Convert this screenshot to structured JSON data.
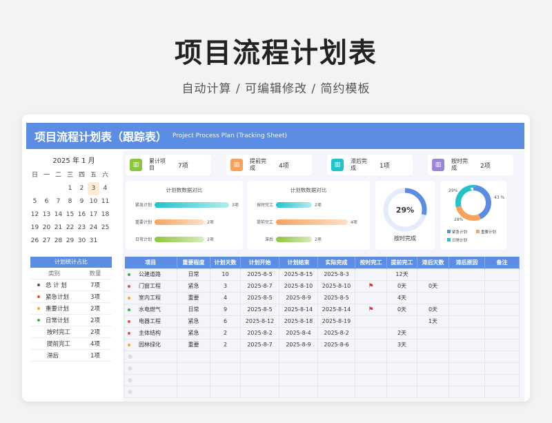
{
  "hero": {
    "title": "项目流程计划表",
    "subtitle": "自动计算 /  可编辑修改  / 简约模板"
  },
  "banner": {
    "title": "项目流程计划表（跟踪表）",
    "subtitle": "Project Process Plan (Tracking Sheet)"
  },
  "calendar": {
    "header": "2025 年  1 月",
    "weekdays": [
      "日",
      "一",
      "二",
      "三",
      "四",
      "五",
      "六"
    ],
    "today": "3",
    "days": [
      "",
      "",
      "",
      "1",
      "2",
      "3",
      "4",
      "5",
      "6",
      "7",
      "8",
      "9",
      "10",
      "11",
      "12",
      "13",
      "14",
      "15",
      "16",
      "17",
      "18",
      "19",
      "20",
      "21",
      "22",
      "23",
      "24",
      "25",
      "26",
      "27",
      "28",
      "29",
      "30",
      "31",
      "",
      ""
    ]
  },
  "stats": {
    "title": "计划统计占比",
    "col_category": "类别",
    "col_count": "数量",
    "rows": [
      {
        "label": "总 计 划",
        "value": "7项",
        "dot": "#555555"
      },
      {
        "label": "紧急计划",
        "value": "3项",
        "dot": "#e84b4b"
      },
      {
        "label": "重要计划",
        "value": "2项",
        "dot": "#f5a623"
      },
      {
        "label": "日常计划",
        "value": "2项",
        "dot": "#34b04a"
      },
      {
        "label": "按时完工",
        "value": "2项",
        "dot": ""
      },
      {
        "label": "提前完工",
        "value": "4项",
        "dot": ""
      },
      {
        "label": "滞后",
        "value": "1项",
        "dot": ""
      }
    ]
  },
  "kpis": [
    {
      "label": "累计项目",
      "value": "7项",
      "color": "#8cc63f",
      "icon": "chart-icon"
    },
    {
      "label": "提前完成",
      "value": "4项",
      "color": "#f7a25c",
      "icon": "chart-icon"
    },
    {
      "label": "滞后完成",
      "value": "1项",
      "color": "#22c3c9",
      "icon": "chart-icon"
    },
    {
      "label": "按时完成",
      "value": "2项",
      "color": "#9b86d9",
      "icon": "chart-icon"
    }
  ],
  "panel1": {
    "title": "计划数数据对比",
    "rows": [
      {
        "label": "紧急计划",
        "value": "3项",
        "num": 3,
        "color": "#22c3c9"
      },
      {
        "label": "重要计划",
        "value": "2项",
        "num": 2,
        "color": "#f7a25c"
      },
      {
        "label": "日常计划",
        "value": "2项",
        "num": 2,
        "color": "#8cc63f"
      }
    ]
  },
  "panel2": {
    "title": "计划数数据对比",
    "rows": [
      {
        "label": "按时完工",
        "value": "2项",
        "num": 2,
        "color": "#22c3c9"
      },
      {
        "label": "提前完工",
        "value": "4项",
        "num": 4,
        "color": "#f7a25c"
      },
      {
        "label": "滞后",
        "value": "2项",
        "num": 2,
        "color": "#8cc63f"
      }
    ]
  },
  "gauge": {
    "percent": "29%",
    "fraction": 0.29,
    "caption": "按时完成"
  },
  "donut": {
    "labels": {
      "a": "29%",
      "b": "43 %",
      "c": "28%"
    },
    "slices": [
      {
        "name": "紧急计划",
        "value": 43,
        "color": "#5b8de5"
      },
      {
        "name": "重要计划",
        "value": 28,
        "color": "#f7a25c"
      },
      {
        "name": "日常计划",
        "value": 29,
        "color": "#22c3c9"
      }
    ],
    "legend": [
      "紧急计划",
      "重要计划",
      "日常计划"
    ]
  },
  "table": {
    "headers": [
      "项目",
      "重要程度",
      "计划天数",
      "计划开始",
      "计划结束",
      "实际完成",
      "按时完工",
      "提前完工",
      "滞后天数",
      "滞后原因",
      "备注"
    ],
    "rows": [
      {
        "dot": "#34b04a",
        "name": "公建道路",
        "level": "日常",
        "days": "10",
        "start": "2025-8-5",
        "end": "2025-8-15",
        "done": "2025-8-3",
        "ontime": "",
        "early": "12天",
        "late": "",
        "reason": "",
        "note": ""
      },
      {
        "dot": "#e84b4b",
        "name": "门窗工程",
        "level": "紧急",
        "days": "3",
        "start": "2025-8-7",
        "end": "2025-8-10",
        "done": "2025-8-10",
        "ontime": "flag",
        "early": "0天",
        "late": "0天",
        "reason": "",
        "note": ""
      },
      {
        "dot": "#f5a623",
        "name": "室内工程",
        "level": "重要",
        "days": "4",
        "start": "2025-8-5",
        "end": "2025-8-9",
        "done": "2025-8-5",
        "ontime": "",
        "early": "4天",
        "late": "",
        "reason": "",
        "note": ""
      },
      {
        "dot": "#34b04a",
        "name": "水电燃气",
        "level": "日常",
        "days": "9",
        "start": "2025-8-5",
        "end": "2025-8-14",
        "done": "2025-8-14",
        "ontime": "flag",
        "early": "0天",
        "late": "0天",
        "reason": "",
        "note": ""
      },
      {
        "dot": "#e84b4b",
        "name": "电器工程",
        "level": "紧急",
        "days": "6",
        "start": "2025-8-12",
        "end": "2025-8-18",
        "done": "2025-8-19",
        "ontime": "",
        "early": "",
        "late": "1天",
        "reason": "",
        "note": ""
      },
      {
        "dot": "#e84b4b",
        "name": "主体结构",
        "level": "紧急",
        "days": "2",
        "start": "2025-8-2",
        "end": "2025-8-4",
        "done": "2025-8-2",
        "ontime": "",
        "early": "2天",
        "late": "",
        "reason": "",
        "note": ""
      },
      {
        "dot": "#f5a623",
        "name": "园林绿化",
        "level": "重要",
        "days": "2",
        "start": "2025-8-7",
        "end": "2025-8-9",
        "done": "2025-8-6",
        "ontime": "",
        "early": "3天",
        "late": "",
        "reason": "",
        "note": ""
      }
    ],
    "empty_rows": 4
  }
}
